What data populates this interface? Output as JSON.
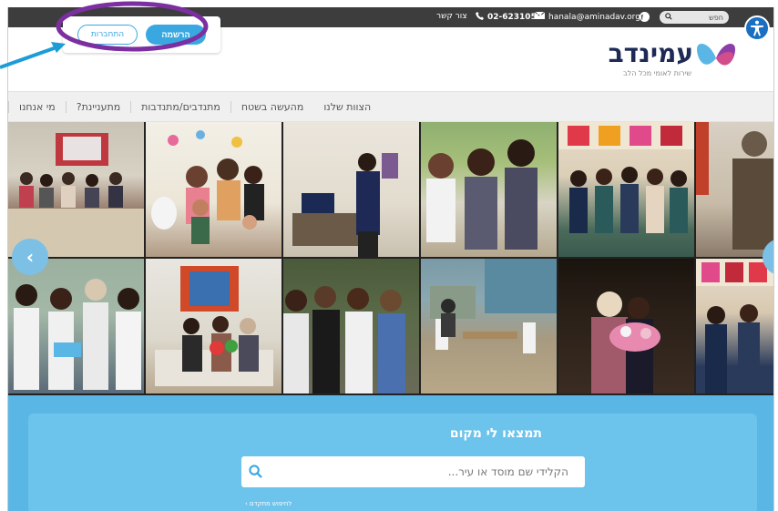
{
  "topbar": {
    "search_label": "חפש",
    "email": "hanala@aminadav.org",
    "phone": "02-6231052",
    "contact": "צור קשר"
  },
  "auth": {
    "register": "הרשמה",
    "login": "התחברות"
  },
  "logo": {
    "name": "עמינדב",
    "tagline": "שירות לאומי מכל הלב"
  },
  "nav": {
    "items": [
      {
        "label": "מי אנחנו"
      },
      {
        "label": "מתעניינת?"
      },
      {
        "label": "מתנדבים/מתנדבות"
      },
      {
        "label": "מהעשה בשטח"
      },
      {
        "label": "הצוות שלנו"
      }
    ]
  },
  "gallery": {
    "prev": "‹",
    "next": "›"
  },
  "search": {
    "title": "תמצאו לי מקום",
    "placeholder": "הקלידי שם מוסד או עיר...",
    "advanced": "לחיפוש מתקדם ›"
  },
  "colors": {
    "accent": "#3aa8e0",
    "topbar": "#3d3d3d",
    "search_bg": "#5ab7e5",
    "annotation": "#7b2fa0",
    "arrow_annotation": "#1e9cd7"
  }
}
